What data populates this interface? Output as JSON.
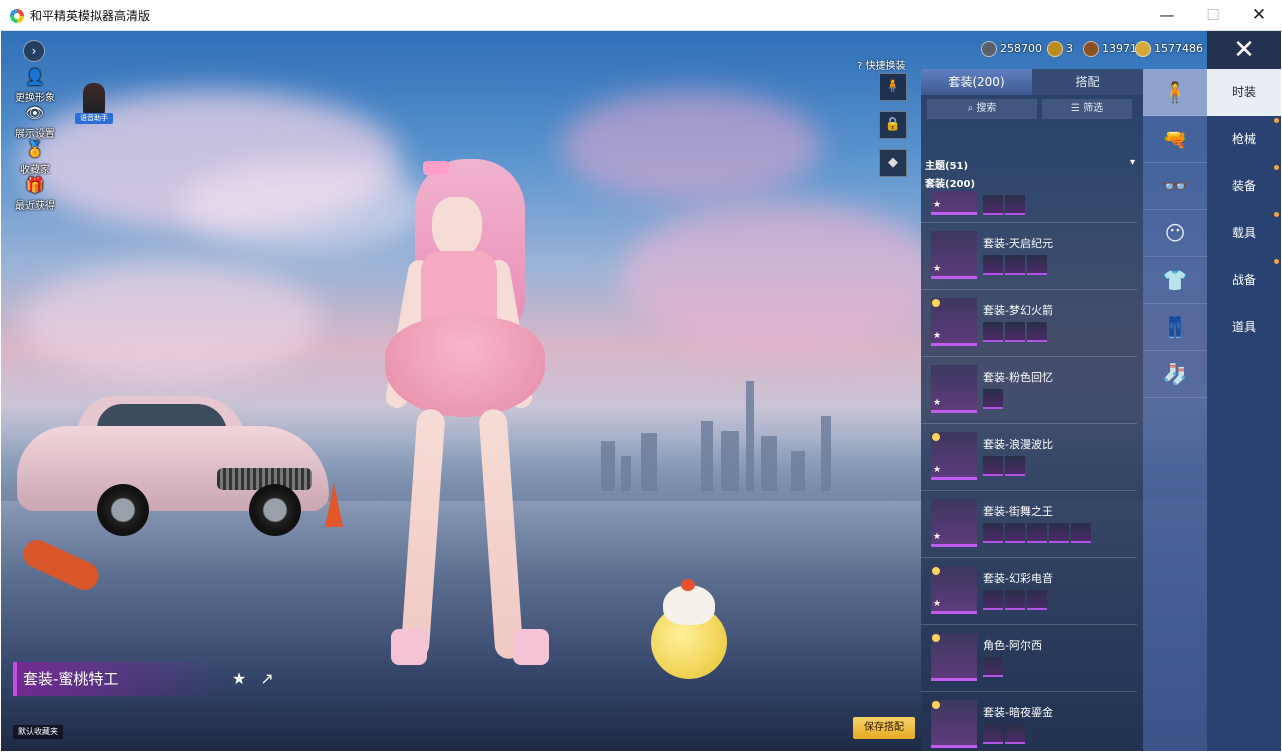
{
  "window": {
    "title": "和平精英模拟器高清版",
    "min_label": "—",
    "max_label": "☐",
    "close_label": "✕"
  },
  "left_tools": {
    "expand_label": "›",
    "change_look": "更换形象",
    "display_settings": "展示设置",
    "collection": "收藏家",
    "recently_obtained": "最近获得",
    "voice_helper": "语音助手"
  },
  "outfit": {
    "current_name": "套装-蜜桃特工",
    "default_fav": "默认收藏夹"
  },
  "currency": [
    {
      "value": "258700",
      "color": "#5a5f6a"
    },
    {
      "value": "3",
      "color": "#b98a1c"
    },
    {
      "value": "13971",
      "color": "#8a4f22"
    },
    {
      "value": "1577486",
      "color": "#d6a83a"
    }
  ],
  "close_label": "✕",
  "quick_change": "快捷换装",
  "panel": {
    "tab_suits": "套装(200)",
    "tab_match": "搭配",
    "search_label": "搜索",
    "filter_label": "筛选",
    "theme_label": "主题(51)",
    "suits_label": "套装(200)",
    "items": [
      {
        "name": "",
        "subs": 2
      },
      {
        "name": "套装-天启纪元",
        "subs": 3
      },
      {
        "name": "套装-梦幻火箭",
        "subs": 3
      },
      {
        "name": "套装-粉色回忆",
        "subs": 1
      },
      {
        "name": "套装-浪漫波比",
        "subs": 2
      },
      {
        "name": "套装-街舞之王",
        "subs": 5
      },
      {
        "name": "套装-幻彩电音",
        "subs": 3
      },
      {
        "name": "角色-阿尔西",
        "subs": 1
      },
      {
        "name": "套装-暗夜鎏金",
        "subs": 2
      }
    ]
  },
  "rail_icons": [
    "outfit-icon",
    "gun-skin-icon",
    "glasses-icon",
    "mask-icon",
    "top-icon",
    "pants-icon",
    "shoes-icon"
  ],
  "categories": {
    "fashion": "时装",
    "firearms": "枪械",
    "equipment": "装备",
    "vehicles": "载具",
    "battle_pet": "战备",
    "props": "道具"
  },
  "save_label": "保存搭配"
}
